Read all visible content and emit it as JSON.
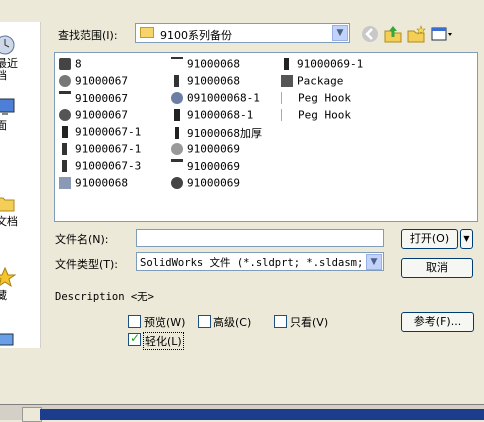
{
  "dialog": {
    "look_in_label": "查找范围(I):",
    "look_in_value": "9100系列备份"
  },
  "places": [
    "最近\n档",
    "面",
    "文档",
    "藏",
    "邻"
  ],
  "files": [
    {
      "name": "8",
      "icon": "part-icon"
    },
    {
      "name": "91000067",
      "icon": "gear-icon"
    },
    {
      "name": "91000067",
      "icon": "assembly-icon"
    },
    {
      "name": "91000067",
      "icon": "gear-icon"
    },
    {
      "name": "91000067-1",
      "icon": "part-icon"
    },
    {
      "name": "91000067-1",
      "icon": "part-icon"
    },
    {
      "name": "91000067-3",
      "icon": "part-icon"
    },
    {
      "name": "91000068",
      "icon": "assembly-icon"
    },
    {
      "name": "91000068",
      "icon": "drawing-icon"
    },
    {
      "name": "91000068",
      "icon": "part-icon"
    },
    {
      "name": "091000068-1",
      "icon": "gear-icon"
    },
    {
      "name": "91000068-1",
      "icon": "part-icon"
    },
    {
      "name": "91000068加厚",
      "icon": "part-icon"
    },
    {
      "name": "91000069",
      "icon": "gear-icon"
    },
    {
      "name": "91000069",
      "icon": "assembly-icon"
    },
    {
      "name": "91000069",
      "icon": "gear-icon"
    },
    {
      "name": "91000069-1",
      "icon": "part-icon"
    },
    {
      "name": "Package",
      "icon": "package-icon"
    },
    {
      "name": "Peg Hook",
      "icon": "drawing-icon"
    },
    {
      "name": "Peg Hook",
      "icon": "drawing-icon"
    }
  ],
  "form": {
    "filename_label": "文件名(N):",
    "filename_value": "",
    "filetype_label": "文件类型(T):",
    "filetype_value": "SolidWorks 文件 (*.sldprt; *.sldasm; *.",
    "open_label": "打开(O)",
    "cancel_label": "取消",
    "description_label": "Description <无>",
    "preview_label": "预览(W)",
    "advanced_label": "高级(C)",
    "readonly_label": "只看(V)",
    "reference_label": "参考(F)...",
    "lightweight_label": "轻化(L)"
  },
  "checkboxes": {
    "preview": false,
    "advanced": false,
    "readonly": false,
    "lightweight": true
  }
}
